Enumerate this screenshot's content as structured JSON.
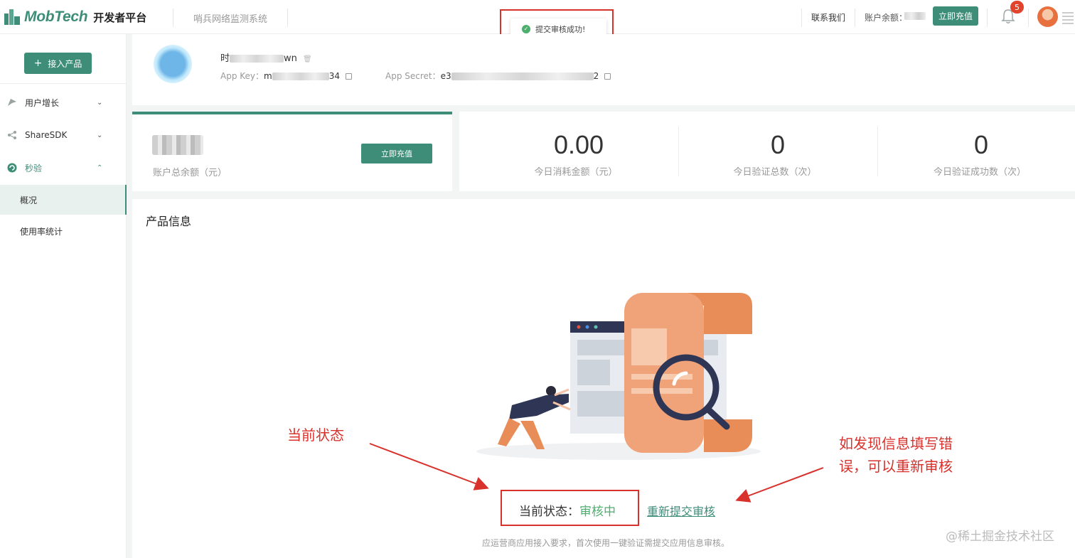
{
  "header": {
    "brand": "MobTech",
    "brand_sub": "开发者平台",
    "system_name": "哨兵网络监测系统",
    "contact": "联系我们",
    "balance_label": "账户余额：",
    "recharge": "立即充值",
    "notification_count": "5",
    "accent_color": "#3e8d78"
  },
  "toast": {
    "message": "提交审核成功!"
  },
  "sidebar": {
    "add_product": "接入产品",
    "items": [
      {
        "label": "用户增长",
        "icon": "growth-icon",
        "expanded": false
      },
      {
        "label": "ShareSDK",
        "icon": "share-icon",
        "expanded": false
      },
      {
        "label": "秒验",
        "icon": "verify-icon",
        "expanded": true
      }
    ],
    "sub_items": [
      {
        "label": "概况",
        "active": true
      },
      {
        "label": "使用率统计",
        "active": false
      }
    ]
  },
  "app": {
    "name_prefix": "时",
    "name_suffix": "wn",
    "key_label": "App Key：",
    "key_prefix": "m",
    "key_suffix": "34",
    "secret_label": "App Secret：",
    "secret_prefix": "e3",
    "secret_suffix": "2"
  },
  "stats": {
    "balance_label": "账户总余额（元）",
    "recharge": "立即充值",
    "items": [
      {
        "value": "0.00",
        "label": "今日消耗金额（元）"
      },
      {
        "value": "0",
        "label": "今日验证总数（次）"
      },
      {
        "value": "0",
        "label": "今日验证成功数（次）"
      }
    ]
  },
  "product": {
    "title": "产品信息",
    "status_label": "当前状态：",
    "status_value": "审核中",
    "resubmit": "重新提交审核",
    "footnote": "应运营商应用接入要求，首次使用一键验证需提交应用信息审核。"
  },
  "annotations": {
    "current_status": "当前状态",
    "resubmit_hint_line1": "如发现信息填写错",
    "resubmit_hint_line2": "误，可以重新审核",
    "color": "#d9312c"
  },
  "watermark": "@稀土掘金技术社区"
}
